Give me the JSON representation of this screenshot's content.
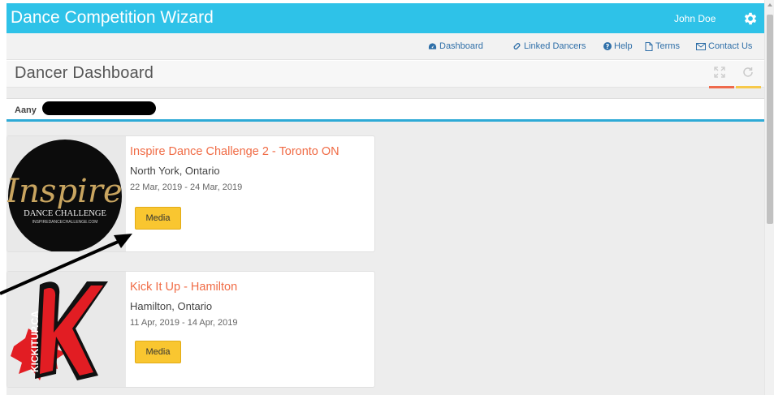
{
  "app": {
    "title": "Dance Competition Wizard",
    "user_name": "John Doe",
    "settings_icon": "gear-icon"
  },
  "nav": {
    "items": [
      {
        "label": "Dashboard",
        "icon": "tachometer-icon"
      },
      {
        "label": "Linked Dancers",
        "icon": "link-icon"
      },
      {
        "label": "Help",
        "icon": "question-circle-icon"
      },
      {
        "label": "Terms",
        "icon": "document-icon"
      },
      {
        "label": "Contact Us",
        "icon": "envelope-icon"
      }
    ]
  },
  "page": {
    "title": "Dancer Dashboard"
  },
  "dancer": {
    "name": "Aany"
  },
  "events": [
    {
      "name": "Inspire Dance Challenge 2 - Toronto ON",
      "location": "North York, Ontario",
      "dates": "22 Mar, 2019 - 24 Mar, 2019",
      "button": "Media",
      "logo": {
        "title": "Inspire",
        "subtitle": "DANCE CHALLENGE",
        "url_text": "INSPIREDANCECHALLENGE.COM"
      }
    },
    {
      "name": "Kick It Up - Hamilton",
      "location": "Hamilton, Ontario",
      "dates": "11 Apr, 2019 - 14 Apr, 2019",
      "button": "Media",
      "logo": {
        "letter": "K",
        "vertical_text": "KICKITUP.CA"
      }
    }
  ],
  "colors": {
    "header": "#2ec2e8",
    "link": "#2f6fa8",
    "event_title": "#f06b45",
    "button": "#f9c630",
    "accent_red": "#ef6a4c",
    "accent_yellow": "#f7c94a"
  }
}
